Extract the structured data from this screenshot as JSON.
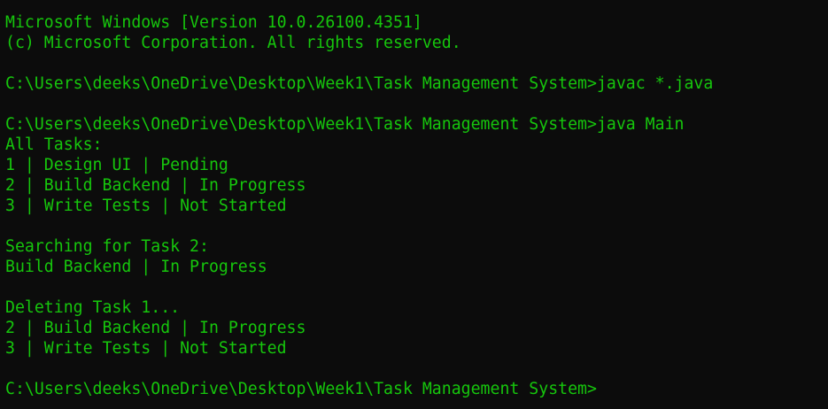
{
  "terminal": {
    "lines": [
      "Microsoft Windows [Version 10.0.26100.4351]",
      "(c) Microsoft Corporation. All rights reserved.",
      "",
      "C:\\Users\\deeks\\OneDrive\\Desktop\\Week1\\Task Management System>javac *.java",
      "",
      "C:\\Users\\deeks\\OneDrive\\Desktop\\Week1\\Task Management System>java Main",
      "All Tasks:",
      "1 | Design UI | Pending",
      "2 | Build Backend | In Progress",
      "3 | Write Tests | Not Started",
      "",
      "Searching for Task 2:",
      "Build Backend | In Progress",
      "",
      "Deleting Task 1...",
      "2 | Build Backend | In Progress",
      "3 | Write Tests | Not Started",
      "",
      "C:\\Users\\deeks\\OneDrive\\Desktop\\Week1\\Task Management System>"
    ]
  },
  "colors": {
    "background": "#0c0c0c",
    "text": "#16c60c"
  }
}
